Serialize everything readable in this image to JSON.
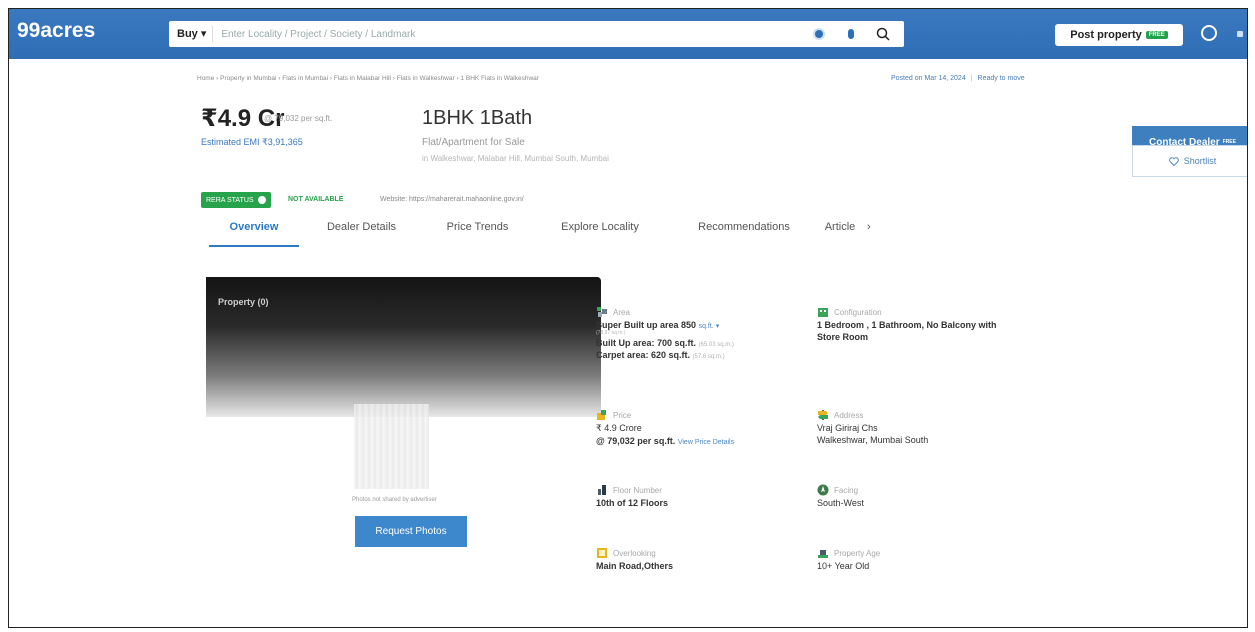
{
  "header": {
    "logo": "99acres",
    "buy_label": "Buy",
    "search_placeholder": "Enter Locality / Project / Society / Landmark",
    "post_property": "Post property",
    "free_tag": "FREE"
  },
  "breadcrumb": "Home › Property in Mumbai › Flats in Mumbai › Flats in Malabar Hill › Flats in Walkeshwar › 1 BHK Flats in Walkeshwar",
  "posted": {
    "date": "Posted on Mar 14, 2024",
    "status": "Ready to move"
  },
  "listing": {
    "price": "₹4.9 Cr",
    "price_per_sqft": "@ 79,032 per sq.ft.",
    "emi": "Estimated EMI ₹3,91,365",
    "bhk": "1BHK 1Bath",
    "flat_type": "Flat/Apartment for Sale",
    "location": "in Walkeshwar, Malabar Hill, Mumbai South, Mumbai"
  },
  "actions": {
    "contact_dealer": "Contact Dealer",
    "contact_tag": "FREE",
    "shortlist": "Shortlist",
    "request_photos": "Request Photos"
  },
  "rera": {
    "label": "RERA STATUS",
    "availability": "NOT AVAILABLE",
    "website": "Website: https://maharerait.mahaonline.gov.in/"
  },
  "tabs": [
    "Overview",
    "Dealer Details",
    "Price Trends",
    "Explore Locality",
    "Recommendations",
    "Article"
  ],
  "photo": {
    "label": "Property (0)",
    "note": "Photos not shared by advertiser"
  },
  "details": {
    "area": {
      "label": "Area",
      "super": "Super Built up area 850",
      "unit": "sq.ft.",
      "super_small": "(78.97 sq.m.)",
      "built": "Built Up area: 700 sq.ft.",
      "built_small": "(65.03 sq.m.)",
      "carpet": "Carpet area: 620 sq.ft.",
      "carpet_small": "(57.6 sq.m.)"
    },
    "configuration": {
      "label": "Configuration",
      "line1": "1 Bedroom , 1 Bathroom, No Balcony with",
      "line2": "Store Room"
    },
    "price": {
      "label": "Price",
      "line1": "₹ 4.9 Crore",
      "line2": "@ 79,032 per sq.ft.",
      "link": "View Price Details"
    },
    "address": {
      "label": "Address",
      "line1": "Vraj Giriraj Chs",
      "line2": "Walkeshwar, Mumbai South"
    },
    "floor": {
      "label": "Floor Number",
      "value": "10th of 12 Floors"
    },
    "facing": {
      "label": "Facing",
      "value": "South-West"
    },
    "overlooking": {
      "label": "Overlooking",
      "value": "Main Road,Others"
    },
    "age": {
      "label": "Property Age",
      "value": "10+ Year Old"
    }
  },
  "colors": {
    "brand": "#2f6db4",
    "green": "#27a34b",
    "link": "#2c79c6"
  }
}
